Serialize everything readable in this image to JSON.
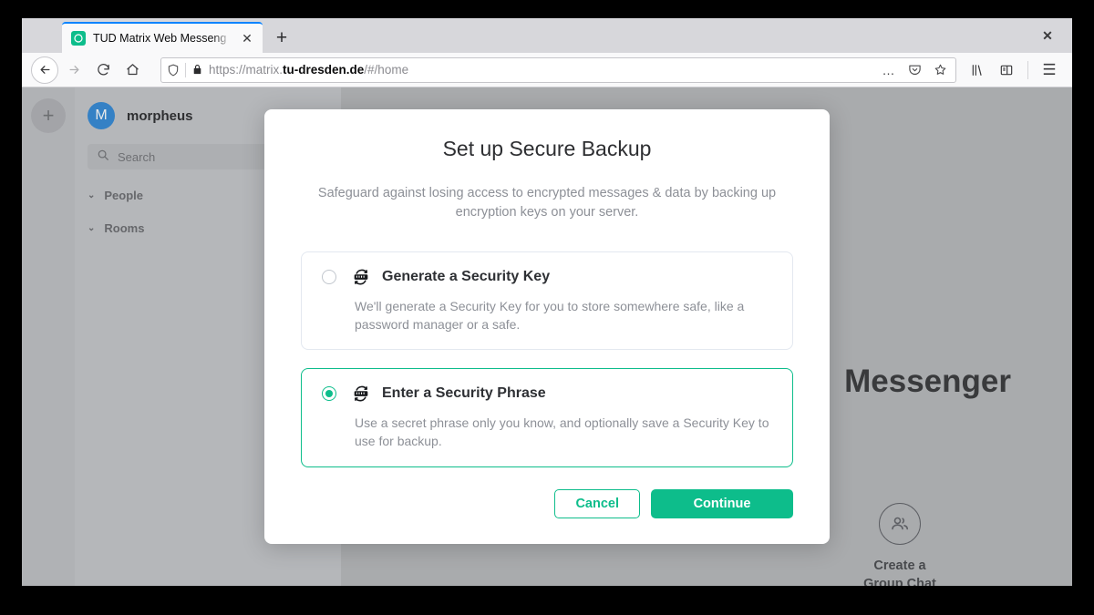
{
  "browser": {
    "tab": {
      "title": "TUD Matrix Web Messeng",
      "favicon_name": "matrix-logo-icon",
      "close_label": "✕"
    },
    "new_tab_label": "+",
    "window_close_label": "✕",
    "nav": {
      "back_label": "←",
      "forward_label": "→",
      "reload_label": "⟳",
      "home_label": "⌂"
    },
    "url": {
      "prefix": "https://matrix.",
      "domain": "tu-dresden.de",
      "path": "/#/home",
      "shield_icon": "tracking-protection-shield-icon",
      "lock_icon": "padlock-icon"
    },
    "urlbar_actions": {
      "more_label": "…",
      "pocket_label": "pocket-icon",
      "bookmark_label": "☆"
    },
    "toolbar_right": {
      "library_label": "library-icon",
      "sidebar_label": "sidebar-icon",
      "menu_label": "☰"
    }
  },
  "app": {
    "rail": {
      "add_label": "+"
    },
    "user": {
      "avatar_initial": "M",
      "name": "morpheus",
      "chevron": "⌄"
    },
    "search": {
      "placeholder": "Search",
      "icon": "search-icon"
    },
    "sections": [
      {
        "label": "People",
        "chevron": "⌄"
      },
      {
        "label": "Rooms",
        "chevron": "⌄"
      }
    ],
    "home": {
      "title": "Messenger",
      "group_chat_label": "Create a\nGroup Chat",
      "group_chat_line1": "Create a",
      "group_chat_line2": "Group Chat"
    }
  },
  "dialog": {
    "title": "Set up Secure Backup",
    "description": "Safeguard against losing access to encrypted messages & data by backing up encryption keys on your server.",
    "options": [
      {
        "title": "Generate a Security Key",
        "description": "We'll generate a Security Key for you to store somewhere safe, like a password manager or a safe.",
        "selected": false,
        "icon": "secure-backup-key-icon"
      },
      {
        "title": "Enter a Security Phrase",
        "description": "Use a secret phrase only you know, and optionally save a Security Key to use for backup.",
        "selected": true,
        "icon": "secure-backup-key-icon"
      }
    ],
    "cancel_label": "Cancel",
    "continue_label": "Continue"
  },
  "colors": {
    "accent": "#0dbd8b",
    "avatar": "#368bd6",
    "tab_active_line": "#0a84ff"
  }
}
